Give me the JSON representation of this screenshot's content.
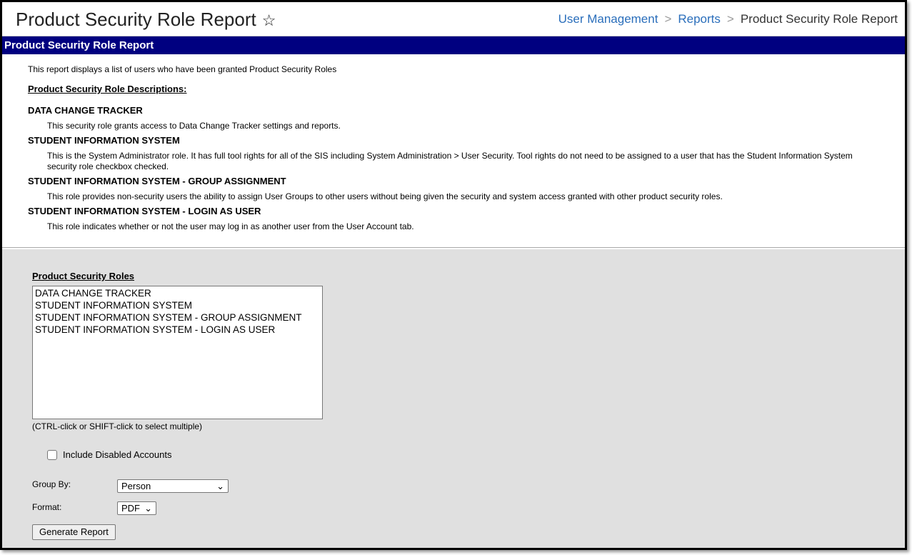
{
  "header": {
    "title": "Product Security Role Report",
    "breadcrumb": [
      "User Management",
      "Reports",
      "Product Security Role Report"
    ]
  },
  "section_title": "Product Security Role Report",
  "intro": "This report displays a list of users who have been granted Product Security Roles",
  "descriptions_heading": "Product Security Role Descriptions:",
  "roles": [
    {
      "name": "DATA CHANGE TRACKER",
      "desc": "This security role grants access to Data Change Tracker settings and reports."
    },
    {
      "name": "STUDENT INFORMATION SYSTEM",
      "desc": "This is the System Administrator role. It has full tool rights for all of the SIS including System Administration > User Security. Tool rights do not need to be assigned to a user that has the Student Information System security role checkbox checked."
    },
    {
      "name": "STUDENT INFORMATION SYSTEM - GROUP ASSIGNMENT",
      "desc": "This role provides non-security users the ability to assign User Groups to other users without being given the security and system access granted with other product security roles."
    },
    {
      "name": "STUDENT INFORMATION SYSTEM - LOGIN AS USER",
      "desc": "This role indicates whether or not the user may log in as another user from the User Account tab."
    }
  ],
  "form": {
    "roles_label": "Product Security Roles",
    "role_options": [
      "DATA CHANGE TRACKER",
      "STUDENT INFORMATION SYSTEM",
      "STUDENT INFORMATION SYSTEM - GROUP ASSIGNMENT",
      "STUDENT INFORMATION SYSTEM - LOGIN AS USER"
    ],
    "hint": "(CTRL-click or SHIFT-click to select multiple)",
    "include_disabled_label": "Include Disabled Accounts",
    "group_by_label": "Group By:",
    "group_by_value": "Person",
    "format_label": "Format:",
    "format_value": "PDF",
    "generate_label": "Generate Report"
  }
}
